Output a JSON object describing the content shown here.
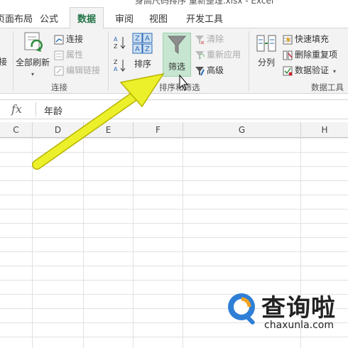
{
  "window": {
    "title": "身高尺码排序 重新整理.xlsx - Excel"
  },
  "tabs": [
    {
      "label": "页面布局"
    },
    {
      "label": "公式"
    },
    {
      "label": "数据"
    },
    {
      "label": "审阅"
    },
    {
      "label": "视图"
    },
    {
      "label": "开发工具"
    }
  ],
  "ribbon": {
    "get_external": {
      "partial_label": "接"
    },
    "connections": {
      "refresh_all": "全部刷新",
      "connections": "连接",
      "properties": "属性",
      "edit_links": "编辑链接",
      "group_label": "连接"
    },
    "sort_filter": {
      "sort": "排序",
      "filter": "筛选",
      "clear": "清除",
      "reapply": "重新应用",
      "advanced": "高级",
      "group_label": "排序和筛选"
    },
    "data_tools": {
      "text_to_columns": "分列",
      "flash_fill": "快速填充",
      "remove_duplicates": "删除重复项",
      "data_validation": "数据验证",
      "group_label": "数据工具"
    }
  },
  "formula_bar": {
    "fx_label": "fx",
    "value": "年龄"
  },
  "columns": [
    "C",
    "D",
    "E",
    "F",
    "G",
    "H"
  ],
  "watermark": {
    "text": "查询啦",
    "url": "chaxunla.com"
  },
  "colors": {
    "accent": "#217346",
    "arrow": "#ecf02a",
    "watermark_blue": "#2f7fd6"
  }
}
